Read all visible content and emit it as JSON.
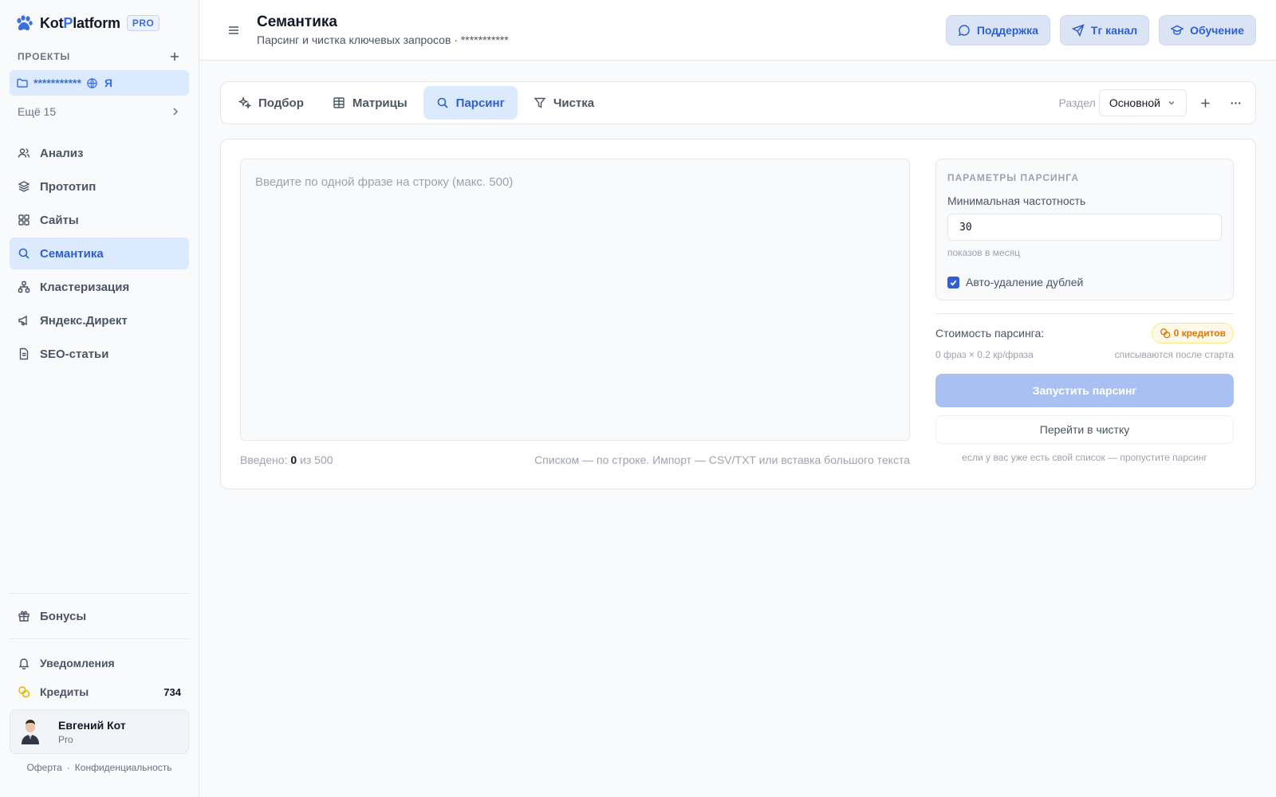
{
  "brand": {
    "name_a": "Kot",
    "name_b": "P",
    "name_c": "latform",
    "badge": "PRO",
    "accent": "#3b6fe0"
  },
  "sidebar": {
    "projects_label": "ПРОЕКТЫ",
    "project": {
      "name": "***********",
      "engine": "Я"
    },
    "more_label": "Ещё 15",
    "items": [
      {
        "label": "Анализ",
        "icon": "users-icon"
      },
      {
        "label": "Прототип",
        "icon": "layers-icon"
      },
      {
        "label": "Сайты",
        "icon": "grid-icon"
      },
      {
        "label": "Семантика",
        "icon": "search-icon",
        "active": true
      },
      {
        "label": "Кластеризация",
        "icon": "cluster-icon"
      },
      {
        "label": "Яндекс.Директ",
        "icon": "megaphone-icon"
      },
      {
        "label": "SEO-статьи",
        "icon": "document-icon"
      }
    ],
    "bonus_label": "Бонусы",
    "notifications_label": "Уведомления",
    "credits_label": "Кредиты",
    "credits_count": "734",
    "user": {
      "name": "Евгений Кот",
      "plan": "Pro"
    },
    "footer": {
      "offer": "Оферта",
      "dot": "·",
      "privacy": "Конфиденциальность"
    }
  },
  "header": {
    "title": "Семантика",
    "subtitle": "Парсинг и чистка ключевых запросов · ***********",
    "buttons": {
      "support": "Поддержка",
      "tg": "Tг канал",
      "learn": "Обучение"
    }
  },
  "tabs": {
    "items": [
      {
        "label": "Подбор",
        "icon": "sparkles-icon"
      },
      {
        "label": "Матрицы",
        "icon": "table-icon"
      },
      {
        "label": "Парсинг",
        "icon": "search-icon",
        "active": true
      },
      {
        "label": "Чистка",
        "icon": "filter-icon"
      }
    ],
    "section_label": "Раздел",
    "section_value": "Основной"
  },
  "parser": {
    "placeholder": "Введите по одной фразе на строку (макс. 500)",
    "entered_prefix": "Введено:",
    "entered_count": "0",
    "entered_suffix": "из 500",
    "hint": "Списком — по строке. Импорт — CSV/TXT или вставка большого текста",
    "params_title": "ПАРАМЕТРЫ ПАРСИНГА",
    "min_freq_label": "Минимальная частотность",
    "min_freq_value": "30",
    "min_freq_help": "показов в месяц",
    "dedupe_label": "Авто-удаление дублей",
    "dedupe_checked": true,
    "cost_label": "Стоимость парсинга:",
    "cost_badge": "0 кредитов",
    "cost_formula": "0 фраз × 0.2 кр/фраза",
    "cost_note": "списываются после старта",
    "start_label": "Запустить парсинг",
    "goto_label": "Перейти в чистку",
    "goto_help": "если у вас уже есть свой список — пропустите парсинг"
  }
}
